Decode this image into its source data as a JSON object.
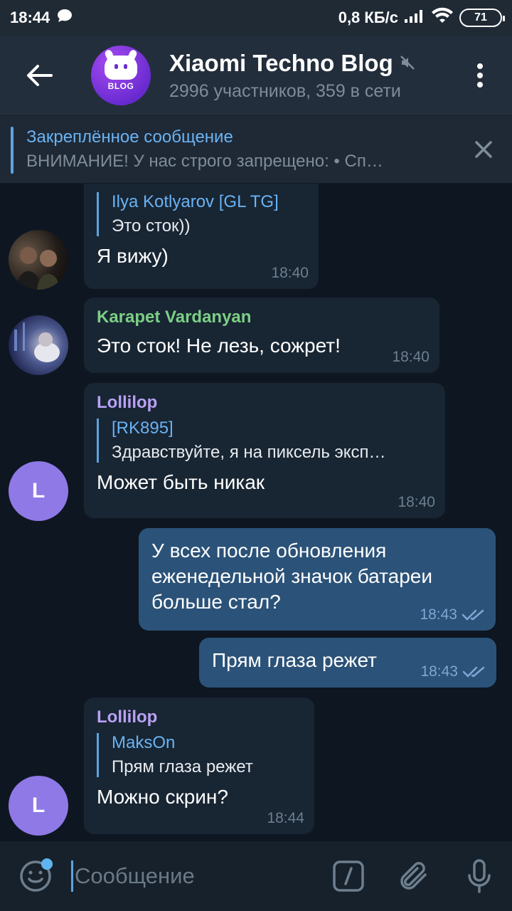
{
  "status_bar": {
    "time": "18:44",
    "network_speed": "0,8 КБ/с",
    "battery": "71"
  },
  "header": {
    "title": "Xiaomi Techno Blog",
    "subtitle": "2996 участников, 359 в сети",
    "avatar_badge": "BLOG"
  },
  "pinned": {
    "title": "Закреплённое сообщение",
    "text": "ВНИМАНИЕ!  У нас строго запрещено:  •  Сп…"
  },
  "messages": [
    {
      "reply_name": "Ilya Kotlyarov [GL TG]",
      "reply_text": "Это сток))",
      "text": "Я вижу)",
      "time": "18:40"
    },
    {
      "sender": "Karapet Vardanyan",
      "text": "Это сток! Не лезь, сожрет!",
      "time": "18:40"
    },
    {
      "sender": "Lollilop",
      "avatar_letter": "L",
      "reply_name": "[RK895]",
      "reply_text": "Здравствуйте, я на пиксель эксп…",
      "text": "Может быть никак",
      "time": "18:40"
    },
    {
      "text": "У всех после обновления еженедельной значок батареи больше стал?",
      "time": "18:43"
    },
    {
      "text": "Прям глаза режет",
      "time": "18:43"
    },
    {
      "sender": "Lollilop",
      "avatar_letter": "L",
      "reply_name": "MaksOn",
      "reply_text": "Прям глаза режет",
      "text": "Можно скрин?",
      "time": "18:44"
    }
  ],
  "input": {
    "placeholder": "Сообщение"
  },
  "colors": {
    "chat_bg": "#0e1621",
    "incoming_bubble": "#182533",
    "outgoing_bubble": "#2b5278",
    "accent": "#6ab3f3",
    "sender_green": "#7ccf85",
    "sender_purple": "#b9a1f5"
  }
}
